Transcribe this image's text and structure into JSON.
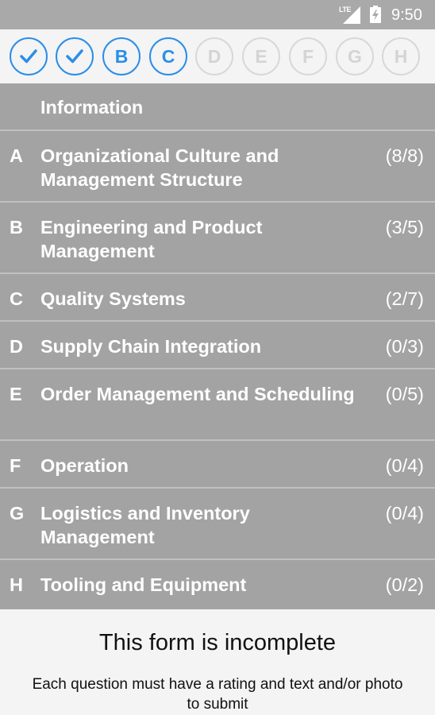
{
  "status_bar": {
    "network": "LTE",
    "time": "9:50"
  },
  "steps": [
    {
      "label": "",
      "state": "done",
      "icon": "check-icon"
    },
    {
      "label": "",
      "state": "done",
      "icon": "check-icon"
    },
    {
      "label": "B",
      "state": "active"
    },
    {
      "label": "C",
      "state": "active"
    },
    {
      "label": "D",
      "state": "inactive"
    },
    {
      "label": "E",
      "state": "inactive"
    },
    {
      "label": "F",
      "state": "inactive"
    },
    {
      "label": "G",
      "state": "inactive"
    },
    {
      "label": "H",
      "state": "inactive"
    }
  ],
  "sections": {
    "info": {
      "title": "Information"
    },
    "items": [
      {
        "letter": "A",
        "title": "Organizational Culture and Management Structure",
        "count": "(8/8)"
      },
      {
        "letter": "B",
        "title": "Engineering and Product Management",
        "count": "(3/5)"
      },
      {
        "letter": "C",
        "title": "Quality Systems",
        "count": "(2/7)"
      },
      {
        "letter": "D",
        "title": "Supply Chain Integration",
        "count": "(0/3)"
      },
      {
        "letter": "E",
        "title": "Order Management and Scheduling",
        "count": "(0/5)"
      },
      {
        "letter": "F",
        "title": "Operation",
        "count": "(0/4)"
      },
      {
        "letter": "G",
        "title": "Logistics and Inventory Management",
        "count": "(0/4)"
      },
      {
        "letter": "H",
        "title": "Tooling and Equipment",
        "count": "(0/2)"
      }
    ]
  },
  "footer": {
    "headline": "This form is incomplete",
    "message": "Each question must have a rating and text and/or photo to submit"
  },
  "colors": {
    "accent": "#2a8ee8",
    "row_bg": "#a3a3a3",
    "status_bar": "#a9a9a9"
  }
}
